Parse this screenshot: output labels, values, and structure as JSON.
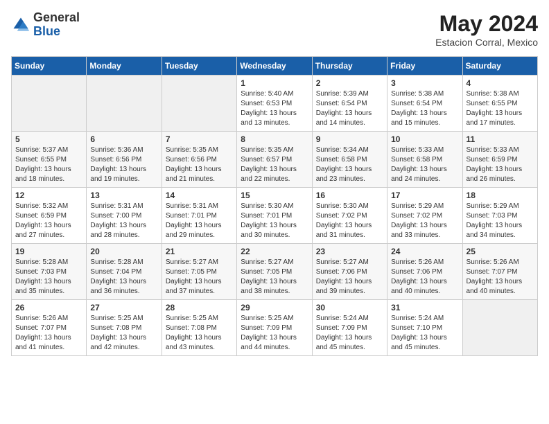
{
  "header": {
    "logo_general": "General",
    "logo_blue": "Blue",
    "title": "May 2024",
    "subtitle": "Estacion Corral, Mexico"
  },
  "days_of_week": [
    "Sunday",
    "Monday",
    "Tuesday",
    "Wednesday",
    "Thursday",
    "Friday",
    "Saturday"
  ],
  "weeks": [
    [
      {
        "day": "",
        "info": ""
      },
      {
        "day": "",
        "info": ""
      },
      {
        "day": "",
        "info": ""
      },
      {
        "day": "1",
        "info": "Sunrise: 5:40 AM\nSunset: 6:53 PM\nDaylight: 13 hours\nand 13 minutes."
      },
      {
        "day": "2",
        "info": "Sunrise: 5:39 AM\nSunset: 6:54 PM\nDaylight: 13 hours\nand 14 minutes."
      },
      {
        "day": "3",
        "info": "Sunrise: 5:38 AM\nSunset: 6:54 PM\nDaylight: 13 hours\nand 15 minutes."
      },
      {
        "day": "4",
        "info": "Sunrise: 5:38 AM\nSunset: 6:55 PM\nDaylight: 13 hours\nand 17 minutes."
      }
    ],
    [
      {
        "day": "5",
        "info": "Sunrise: 5:37 AM\nSunset: 6:55 PM\nDaylight: 13 hours\nand 18 minutes."
      },
      {
        "day": "6",
        "info": "Sunrise: 5:36 AM\nSunset: 6:56 PM\nDaylight: 13 hours\nand 19 minutes."
      },
      {
        "day": "7",
        "info": "Sunrise: 5:35 AM\nSunset: 6:56 PM\nDaylight: 13 hours\nand 21 minutes."
      },
      {
        "day": "8",
        "info": "Sunrise: 5:35 AM\nSunset: 6:57 PM\nDaylight: 13 hours\nand 22 minutes."
      },
      {
        "day": "9",
        "info": "Sunrise: 5:34 AM\nSunset: 6:58 PM\nDaylight: 13 hours\nand 23 minutes."
      },
      {
        "day": "10",
        "info": "Sunrise: 5:33 AM\nSunset: 6:58 PM\nDaylight: 13 hours\nand 24 minutes."
      },
      {
        "day": "11",
        "info": "Sunrise: 5:33 AM\nSunset: 6:59 PM\nDaylight: 13 hours\nand 26 minutes."
      }
    ],
    [
      {
        "day": "12",
        "info": "Sunrise: 5:32 AM\nSunset: 6:59 PM\nDaylight: 13 hours\nand 27 minutes."
      },
      {
        "day": "13",
        "info": "Sunrise: 5:31 AM\nSunset: 7:00 PM\nDaylight: 13 hours\nand 28 minutes."
      },
      {
        "day": "14",
        "info": "Sunrise: 5:31 AM\nSunset: 7:01 PM\nDaylight: 13 hours\nand 29 minutes."
      },
      {
        "day": "15",
        "info": "Sunrise: 5:30 AM\nSunset: 7:01 PM\nDaylight: 13 hours\nand 30 minutes."
      },
      {
        "day": "16",
        "info": "Sunrise: 5:30 AM\nSunset: 7:02 PM\nDaylight: 13 hours\nand 31 minutes."
      },
      {
        "day": "17",
        "info": "Sunrise: 5:29 AM\nSunset: 7:02 PM\nDaylight: 13 hours\nand 33 minutes."
      },
      {
        "day": "18",
        "info": "Sunrise: 5:29 AM\nSunset: 7:03 PM\nDaylight: 13 hours\nand 34 minutes."
      }
    ],
    [
      {
        "day": "19",
        "info": "Sunrise: 5:28 AM\nSunset: 7:03 PM\nDaylight: 13 hours\nand 35 minutes."
      },
      {
        "day": "20",
        "info": "Sunrise: 5:28 AM\nSunset: 7:04 PM\nDaylight: 13 hours\nand 36 minutes."
      },
      {
        "day": "21",
        "info": "Sunrise: 5:27 AM\nSunset: 7:05 PM\nDaylight: 13 hours\nand 37 minutes."
      },
      {
        "day": "22",
        "info": "Sunrise: 5:27 AM\nSunset: 7:05 PM\nDaylight: 13 hours\nand 38 minutes."
      },
      {
        "day": "23",
        "info": "Sunrise: 5:27 AM\nSunset: 7:06 PM\nDaylight: 13 hours\nand 39 minutes."
      },
      {
        "day": "24",
        "info": "Sunrise: 5:26 AM\nSunset: 7:06 PM\nDaylight: 13 hours\nand 40 minutes."
      },
      {
        "day": "25",
        "info": "Sunrise: 5:26 AM\nSunset: 7:07 PM\nDaylight: 13 hours\nand 40 minutes."
      }
    ],
    [
      {
        "day": "26",
        "info": "Sunrise: 5:26 AM\nSunset: 7:07 PM\nDaylight: 13 hours\nand 41 minutes."
      },
      {
        "day": "27",
        "info": "Sunrise: 5:25 AM\nSunset: 7:08 PM\nDaylight: 13 hours\nand 42 minutes."
      },
      {
        "day": "28",
        "info": "Sunrise: 5:25 AM\nSunset: 7:08 PM\nDaylight: 13 hours\nand 43 minutes."
      },
      {
        "day": "29",
        "info": "Sunrise: 5:25 AM\nSunset: 7:09 PM\nDaylight: 13 hours\nand 44 minutes."
      },
      {
        "day": "30",
        "info": "Sunrise: 5:24 AM\nSunset: 7:09 PM\nDaylight: 13 hours\nand 45 minutes."
      },
      {
        "day": "31",
        "info": "Sunrise: 5:24 AM\nSunset: 7:10 PM\nDaylight: 13 hours\nand 45 minutes."
      },
      {
        "day": "",
        "info": ""
      }
    ]
  ]
}
